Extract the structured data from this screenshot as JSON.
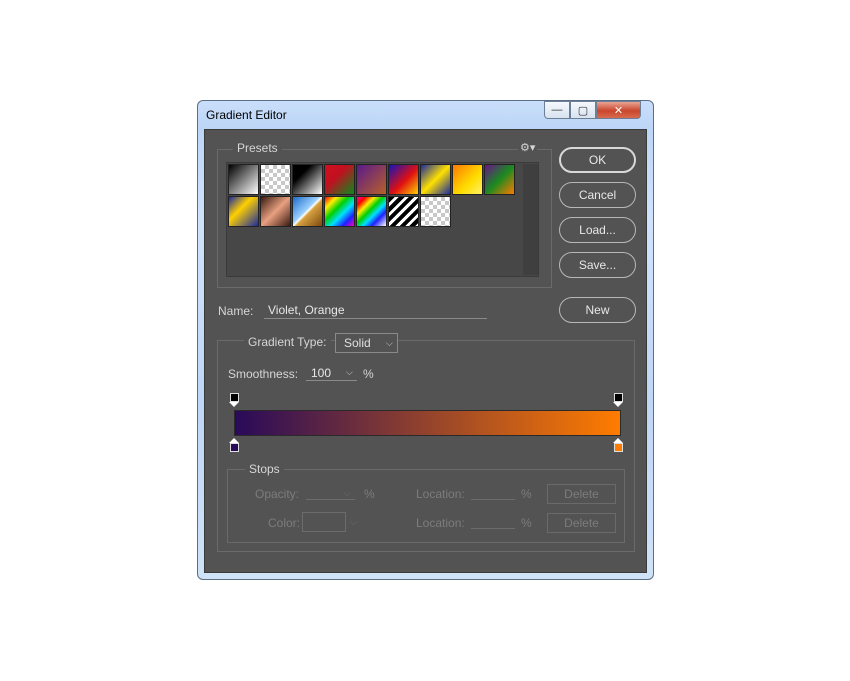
{
  "window": {
    "title": "Gradient Editor",
    "minimize": "—",
    "maximize": "▢",
    "close": "✕"
  },
  "presets": {
    "label": "Presets",
    "gear": "⚙▾",
    "swatches": [
      {
        "name": "swatch-1",
        "css": "linear-gradient(135deg,#000 0%,#fff 100%)"
      },
      {
        "name": "swatch-2",
        "css": "checker"
      },
      {
        "name": "swatch-3",
        "css": "linear-gradient(135deg,#000 0%,#000 30%,#fff 100%)"
      },
      {
        "name": "swatch-4",
        "css": "linear-gradient(135deg,#d01020 0%,#c01020 40%,#0c8a1e 100%)"
      },
      {
        "name": "swatch-5",
        "css": "linear-gradient(135deg,#5a1a8a 0%,#b8602a 100%)"
      },
      {
        "name": "swatch-6",
        "css": "linear-gradient(135deg,#1414b8 0%,#e01010 55%,#ffd200 100%)"
      },
      {
        "name": "swatch-7",
        "css": "linear-gradient(135deg,#1a2aa0 0%,#ffe000 50%,#1a2aa0 100%)"
      },
      {
        "name": "swatch-8",
        "css": "linear-gradient(135deg,#ff7a00 0%,#ffdd00 60%,#fff06a 100%)"
      },
      {
        "name": "swatch-9",
        "css": "linear-gradient(135deg,#6a138a 0%,#1a8a20 50%,#ff7a00 100%)"
      },
      {
        "name": "swatch-10",
        "css": "linear-gradient(135deg,#1a2aa0 0%,#ffd000 40%,#1a2aa0 100%)"
      },
      {
        "name": "swatch-11",
        "css": "linear-gradient(135deg,#3a1a10 0%,#e8a080 50%,#3a1a10 100%)"
      },
      {
        "name": "swatch-12",
        "css": "linear-gradient(135deg,#1c6cc8 0%,#9bd0ff 45%,#fff 50%,#d8a040 55%,#7a4a10 100%)"
      },
      {
        "name": "swatch-13",
        "css": "linear-gradient(135deg,#ff0000 0%,#ffee00 20%,#00d000 40%,#00e0ff 60%,#2020ff 80%,#ff00c0 100%)"
      },
      {
        "name": "swatch-14",
        "css": "linear-gradient(135deg,#ff00a0 0%,#ff0000 15%,#ffee00 30%,#00d000 45%,#00e0ff 60%,#2020ff 75%,#fff 100%)"
      },
      {
        "name": "swatch-15",
        "css": "repeating-linear-gradient(135deg,#000 0px,#000 4px,#fff 4px,#fff 7px)"
      },
      {
        "name": "swatch-16",
        "css": "checker"
      }
    ]
  },
  "buttons": {
    "ok": "OK",
    "cancel": "Cancel",
    "load": "Load...",
    "save": "Save...",
    "new": "New"
  },
  "name_field": {
    "label": "Name:",
    "value": "Violet, Orange"
  },
  "gradient_type": {
    "label": "Gradient Type:",
    "value": "Solid"
  },
  "smoothness": {
    "label": "Smoothness:",
    "value": "100",
    "unit": "%"
  },
  "gradient": {
    "start_color": "#290a59",
    "end_color": "#ff7c00"
  },
  "stops": {
    "label": "Stops",
    "opacity_label": "Opacity:",
    "opacity_unit": "%",
    "location_label": "Location:",
    "location_unit": "%",
    "color_label": "Color:",
    "delete_label": "Delete"
  }
}
